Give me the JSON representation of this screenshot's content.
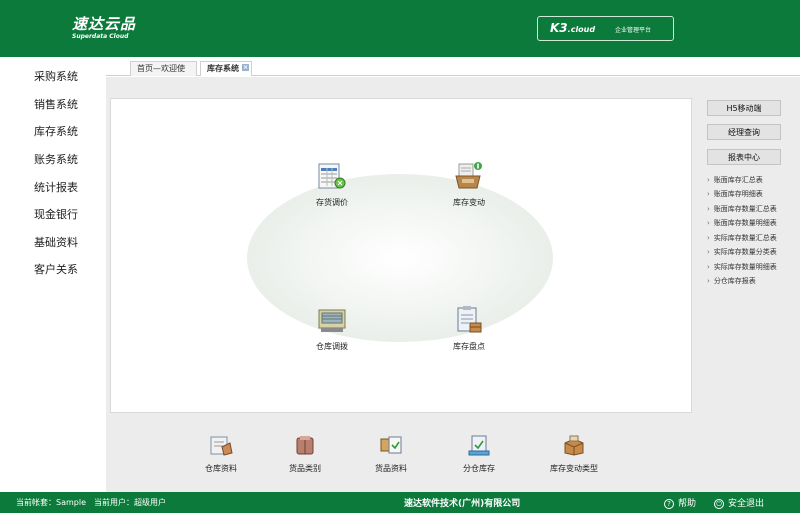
{
  "header": {
    "logo_cn": "速达云品",
    "logo_en": "Superdata Cloud",
    "k3_brand": "K3",
    "k3_cloud": ".cloud",
    "k3_sub": "企业管理平台"
  },
  "sidebar": {
    "items": [
      {
        "label": "采购系统"
      },
      {
        "label": "销售系统"
      },
      {
        "label": "库存系统"
      },
      {
        "label": "账务系统"
      },
      {
        "label": "统计报表"
      },
      {
        "label": "现金银行"
      },
      {
        "label": "基础资料"
      },
      {
        "label": "客户关系"
      }
    ]
  },
  "tabs": [
    {
      "label": "首页—欢迎使用"
    },
    {
      "label": "库存系统",
      "close": "×"
    }
  ],
  "main": {
    "functions": [
      {
        "label": "存货调价",
        "icon": "price-adjust-icon"
      },
      {
        "label": "库存变动",
        "icon": "inventory-change-icon"
      },
      {
        "label": "仓库调拨",
        "icon": "warehouse-transfer-icon"
      },
      {
        "label": "库存盘点",
        "icon": "stocktake-icon"
      }
    ]
  },
  "right": {
    "buttons": [
      "H5移动端",
      "经理查询",
      "报表中心"
    ],
    "links": [
      "账面库存汇总表",
      "账面库存明细表",
      "账面库存数量汇总表",
      "账面库存数量明细表",
      "实际库存数量汇总表",
      "实际库存数量分类表",
      "实际库存数量明细表",
      "分仓库存报表"
    ],
    "arrow": "›"
  },
  "bottom": {
    "items": [
      {
        "label": "仓库资料",
        "icon": "warehouse-info-icon"
      },
      {
        "label": "货品类别",
        "icon": "goods-category-icon"
      },
      {
        "label": "货品资料",
        "icon": "goods-info-icon"
      },
      {
        "label": "分仓库存",
        "icon": "branch-stock-icon"
      },
      {
        "label": "库存变动类型",
        "icon": "change-type-icon"
      }
    ]
  },
  "footer": {
    "account": "当前帐套：Sample　当前用户：超级用户",
    "company": "速达软件技术(广州)有限公司",
    "help": "帮助",
    "help_symbol": "?",
    "exit": "安全退出",
    "exit_symbol": "⏻"
  },
  "colors": {
    "brand_green": "#0b7a3a",
    "panel_bg": "#ececec"
  }
}
